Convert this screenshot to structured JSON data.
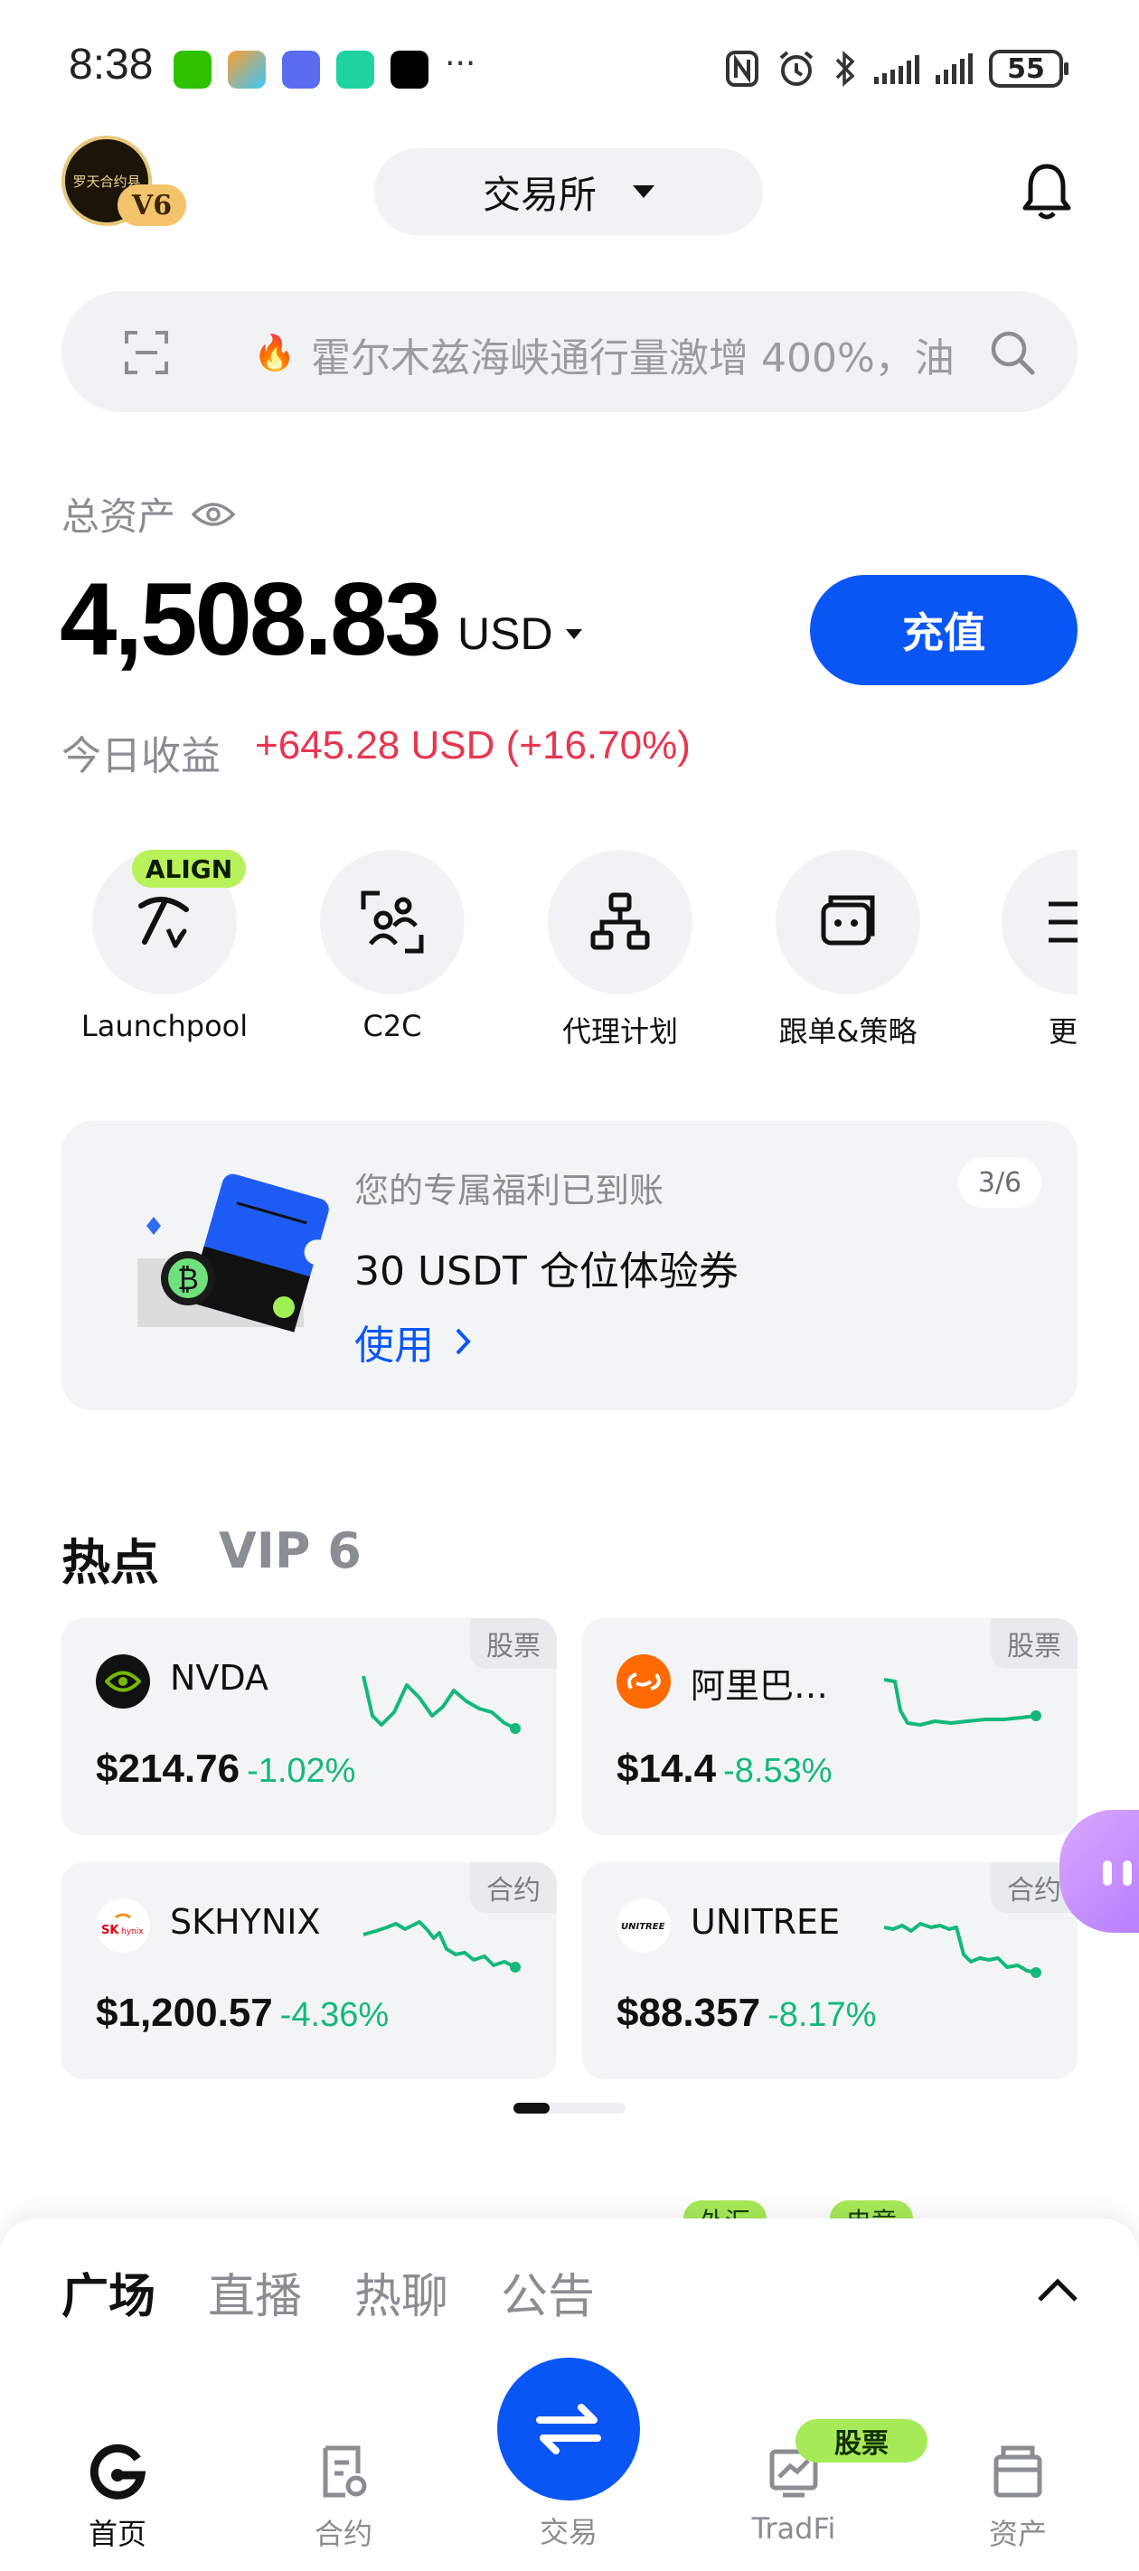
{
  "status_bar": {
    "time": "8:38",
    "more": "···",
    "battery": "55",
    "apps": [
      {
        "name": "wechat-icon",
        "color": "#2dc100"
      },
      {
        "name": "colorful-app-icon",
        "color": "#ff9f2e"
      },
      {
        "name": "blue-app-icon",
        "color": "#5a6cf0"
      },
      {
        "name": "camera-app-icon",
        "color": "#1fd3a0"
      },
      {
        "name": "tiktok-icon",
        "color": "#000000"
      }
    ]
  },
  "header": {
    "avatar_text": "罗天合约县",
    "vip_badge": "V6",
    "exchange_selector": "交易所"
  },
  "search": {
    "placeholder": "霍尔木兹海峡通行量激增 400%，油"
  },
  "assets": {
    "label": "总资产",
    "value": "4,508.83",
    "currency": "USD",
    "deposit_button": "充值",
    "pnl_label": "今日收益",
    "pnl_value": "+645.28 USD (+16.70%)"
  },
  "shortcuts": [
    {
      "label": "Launchpool",
      "badge": "ALIGN"
    },
    {
      "label": "C2C"
    },
    {
      "label": "代理计划"
    },
    {
      "label": "跟单&策略"
    },
    {
      "label": "更"
    }
  ],
  "promo": {
    "subtitle": "您的专属福利已到账",
    "title": "30 USDT 仓位体验券",
    "action": "使用",
    "pager": "3/6"
  },
  "hot": {
    "title": "热点",
    "vip_tab": "VIP 6",
    "cards": [
      {
        "name": "NVDA",
        "tag": "股票",
        "price": "$214.76",
        "change": "-1.02%"
      },
      {
        "name": "阿里巴…",
        "tag": "股票",
        "price": "$14.4",
        "change": "-8.53%"
      },
      {
        "name": "SKHYNIX",
        "tag": "合约",
        "price": "$1,200.57",
        "change": "-4.36%"
      },
      {
        "name": "UNITREE",
        "tag": "合约",
        "price": "$88.357",
        "change": "-8.17%"
      }
    ]
  },
  "peek_badges": [
    "外汇",
    "电竞"
  ],
  "feed_tabs": [
    "广场",
    "直播",
    "热聊",
    "公告"
  ],
  "bottom_nav": {
    "home": "首页",
    "futures": "合约",
    "trade": "交易",
    "tradfi": "TradFi",
    "tradfi_badge": "股票",
    "assets": "资产"
  },
  "colors": {
    "accent": "#0a56f5",
    "loss": "#14b87a",
    "gain": "#e8364f",
    "badge_green": "#a6ea58"
  }
}
